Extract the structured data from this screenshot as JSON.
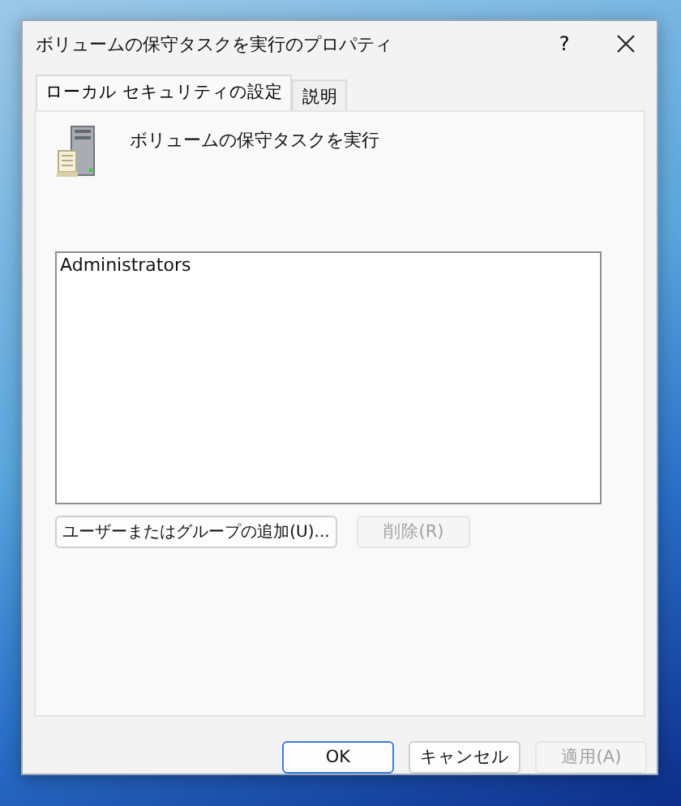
{
  "window": {
    "title": "ボリュームの保守タスクを実行のプロパティ",
    "help": "?"
  },
  "tabs": [
    {
      "label": "ローカル セキュリティの設定",
      "selected": true
    },
    {
      "label": "説明",
      "selected": false
    }
  ],
  "policy": {
    "name": "ボリュームの保守タスクを実行"
  },
  "members": [
    {
      "name": "Administrators",
      "selected": false
    }
  ],
  "member_buttons": [
    {
      "label": "ユーザーまたはグループの追加(U)...",
      "disabled": false
    },
    {
      "label": "削除(R)",
      "disabled": true
    }
  ],
  "buttons": [
    {
      "label": "OK",
      "disabled": false,
      "default": true
    },
    {
      "label": "キャンセル",
      "disabled": false,
      "default": false
    },
    {
      "label": "適用(A)",
      "disabled": true,
      "default": false
    }
  ]
}
